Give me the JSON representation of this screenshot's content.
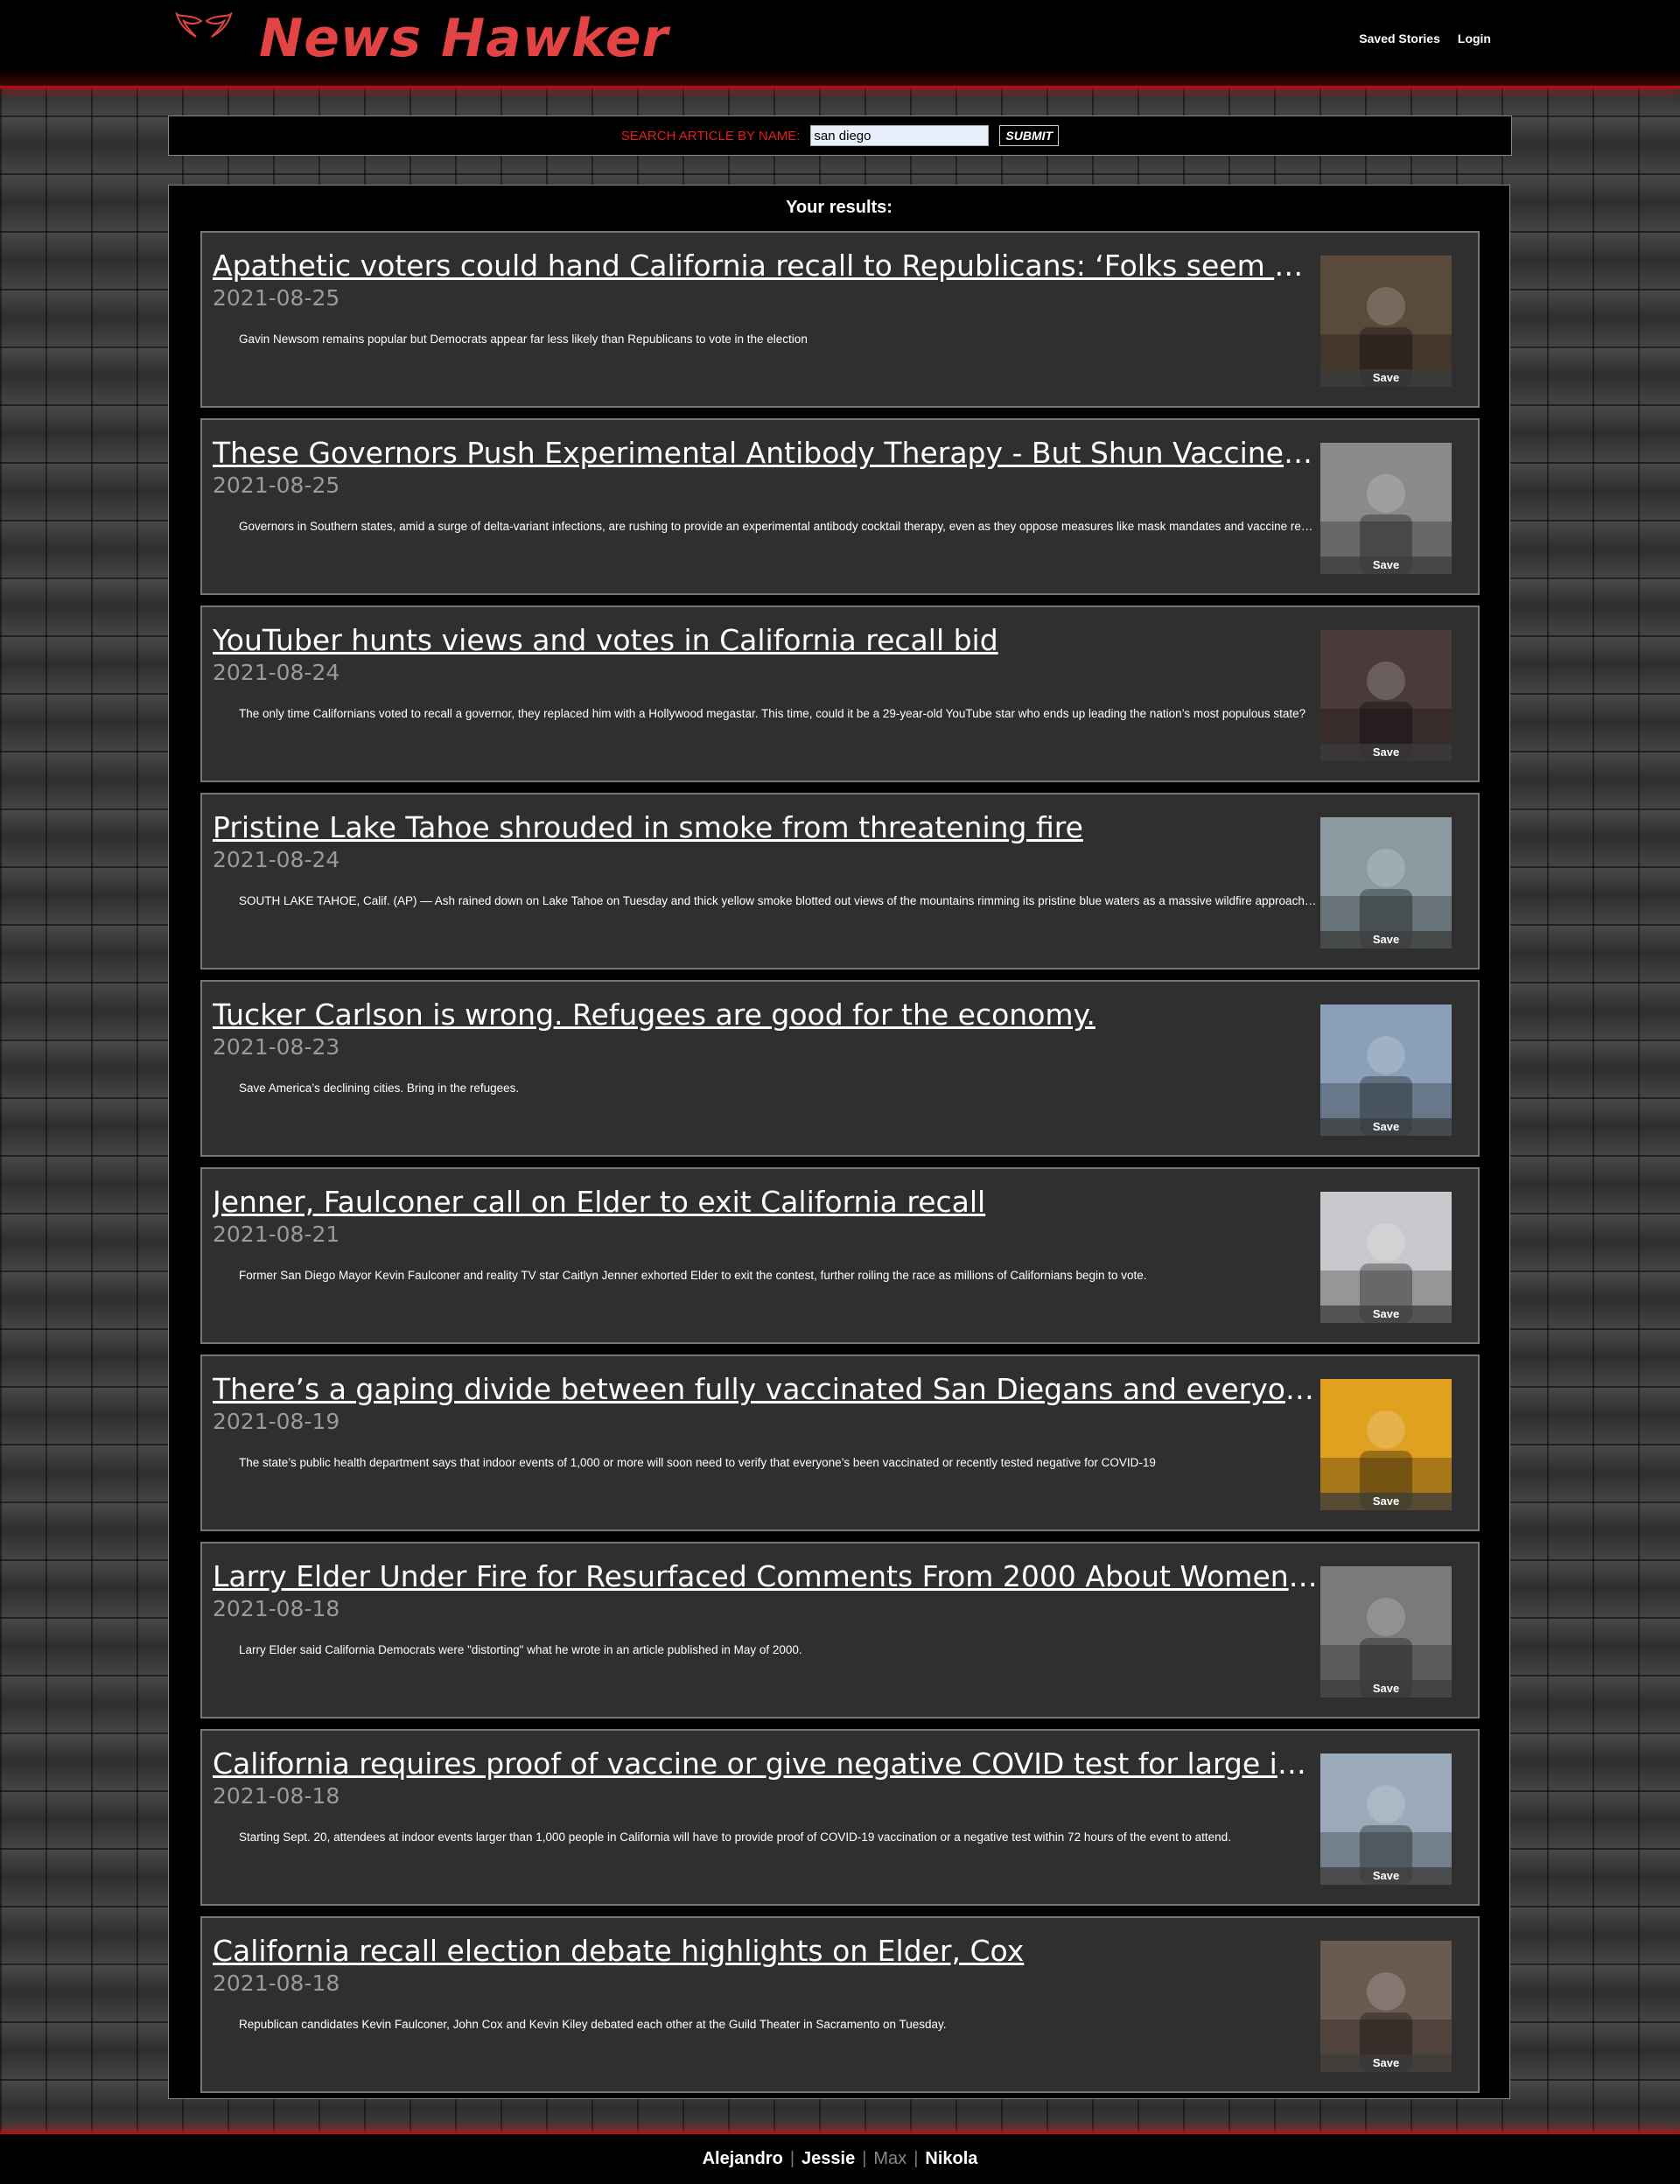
{
  "header": {
    "app_title": "News Hawker",
    "logo_icon": "wings-icon",
    "nav": [
      "Saved Stories",
      "Login"
    ]
  },
  "search": {
    "label": "SEARCH ARTICLE BY NAME:",
    "value": "san diego",
    "submit_label": "SUBMIT"
  },
  "results": {
    "title": "Your results:",
    "save_label": "Save",
    "articles": [
      {
        "title": "Apathetic voters could hand California recall to Republicans: ‘Folks seem unaware’",
        "date": "2021-08-25",
        "description": "Gavin Newsom remains popular but Democrats appear far less likely than Republicans to vote in the election",
        "thumb_color": "#5a4a3a"
      },
      {
        "title": "These Governors Push Experimental Antibody Therapy - But Shun Vaccine and Mask Mandates",
        "date": "2021-08-25",
        "description": "Governors in Southern states, amid a surge of delta-variant infections, are rushing to provide an experimental antibody cocktail therapy, even as they oppose measures like mask mandates and vaccine requirements.",
        "thumb_color": "#8a8a8a"
      },
      {
        "title": "YouTuber hunts views and votes in California recall bid",
        "date": "2021-08-24",
        "description": "The only time Californians voted to recall a governor, they replaced him with a Hollywood megastar. This time, could it be a 29-year-old YouTube star who ends up leading the nation’s most populous state?",
        "thumb_color": "#4a3a3a"
      },
      {
        "title": "Pristine Lake Tahoe shrouded in smoke from threatening fire",
        "date": "2021-08-24",
        "description": "SOUTH LAKE TAHOE, Calif. (AP) — Ash rained down on Lake Tahoe on Tuesday and thick yellow smoke blotted out views of the mountains rimming its pristine blue waters as a massive wildfire approached.",
        "thumb_color": "#8a9aa0"
      },
      {
        "title": "Tucker Carlson is wrong. Refugees are good for the economy.",
        "date": "2021-08-23",
        "description": "Save America’s declining cities. Bring in the refugees.",
        "thumb_color": "#8aa0b8"
      },
      {
        "title": "Jenner, Faulconer call on Elder to exit California recall",
        "date": "2021-08-21",
        "description": "Former San Diego Mayor Kevin Faulconer and reality TV star Caitlyn Jenner exhorted Elder to exit the contest, further roiling the race as millions of Californians begin to vote.",
        "thumb_color": "#c8c8cc"
      },
      {
        "title": "There’s a gaping divide between fully vaccinated San Diegans and everyone else",
        "date": "2021-08-19",
        "description": "The state’s public health department says that indoor events of 1,000 or more will soon need to verify that everyone’s been vaccinated or recently tested negative for COVID-19",
        "thumb_color": "#e0a020"
      },
      {
        "title": "Larry Elder Under Fire for Resurfaced Comments From 2000 About Women Voters",
        "date": "2021-08-18",
        "description": "Larry Elder said California Democrats were \"distorting\" what he wrote in an article published in May of 2000.",
        "thumb_color": "#7a7a7a"
      },
      {
        "title": "California requires proof of vaccine or give negative COVID test for large indoor events",
        "date": "2021-08-18",
        "description": "Starting Sept. 20, attendees at indoor events larger than 1,000 people in California will have to provide proof of COVID-19 vaccination or a negative test within 72 hours of the event to attend.",
        "thumb_color": "#9aaab8"
      },
      {
        "title": "California recall election debate highlights on Elder, Cox",
        "date": "2021-08-18",
        "description": "Republican candidates Kevin Faulconer, John Cox and Kevin Kiley debated each other at the Guild Theater in Sacramento on Tuesday.",
        "thumb_color": "#6a5a50"
      }
    ]
  },
  "footer": {
    "names": [
      "Alejandro",
      "Jessie",
      "Max",
      "Nikola"
    ]
  },
  "colors": {
    "brand": "#e24444",
    "accent_red": "#b01010",
    "card_bg": "#2f2f2f"
  }
}
